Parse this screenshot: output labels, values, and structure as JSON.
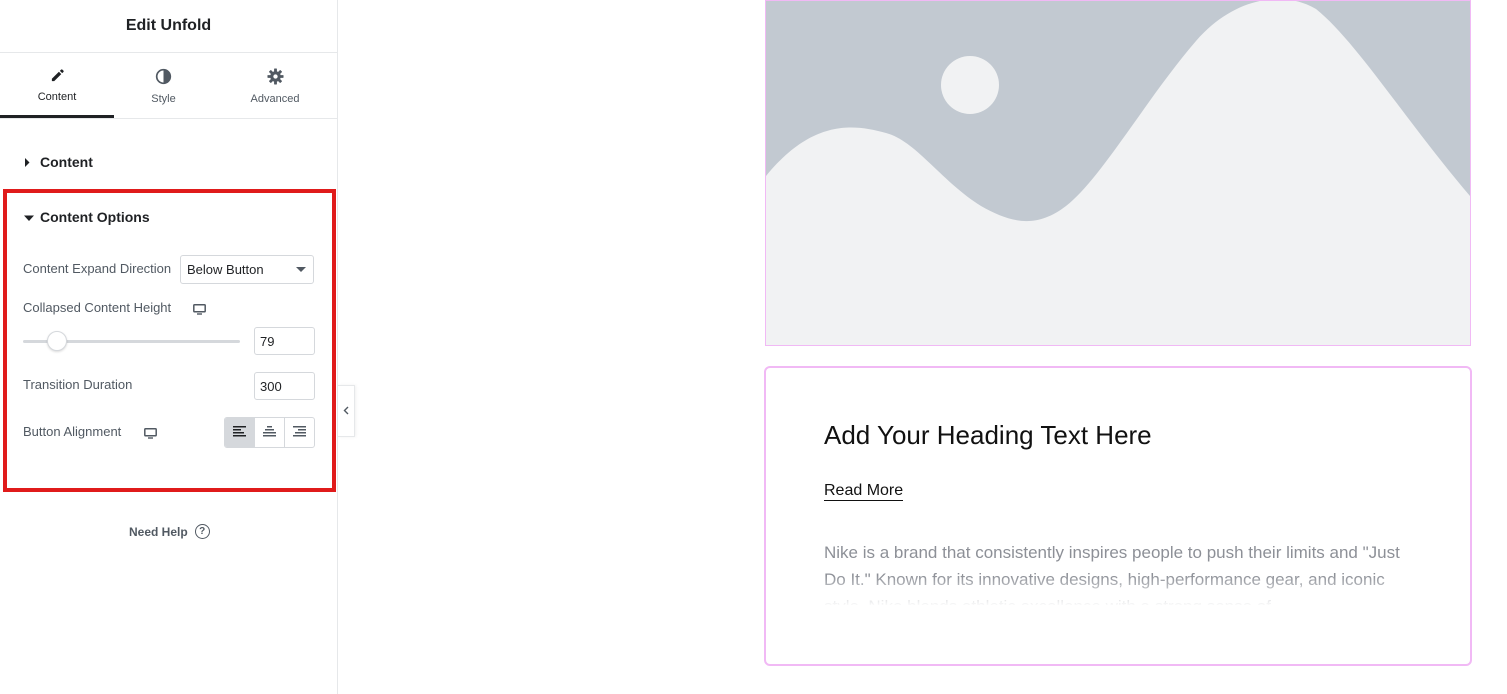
{
  "panel": {
    "title": "Edit Unfold",
    "tabs": [
      {
        "label": "Content",
        "icon": "pencil-icon"
      },
      {
        "label": "Style",
        "icon": "half-circle-icon"
      },
      {
        "label": "Advanced",
        "icon": "gear-icon"
      }
    ],
    "active_tab": "Content",
    "sections": {
      "content": {
        "title": "Content",
        "expanded": false
      },
      "content_options": {
        "title": "Content Options",
        "expanded": true,
        "expand_direction": {
          "label": "Content Expand Direction",
          "value": "Below Button"
        },
        "collapsed_height": {
          "label": "Collapsed Content Height",
          "value": "79",
          "device_icon": "desktop-icon"
        },
        "transition_duration": {
          "label": "Transition Duration",
          "value": "300"
        },
        "button_alignment": {
          "label": "Button Alignment",
          "device_icon": "desktop-icon",
          "options": [
            "left",
            "center",
            "right"
          ],
          "selected": "left"
        }
      }
    },
    "need_help": "Need Help",
    "colors": {
      "highlight": "#e01b1b",
      "text_dark": "#1f2124",
      "text_muted": "#515962"
    }
  },
  "preview": {
    "heading": "Add Your Heading Text Here",
    "read_more": "Read More",
    "paragraph": "Nike is a brand that consistently inspires people to push their limits and \"Just Do It.\" Known for its innovative designs, high-performance gear, and iconic style, Nike blends athletic excellence with a strong sense of",
    "image_placeholder_icon": "image-placeholder-icon",
    "colors": {
      "border": "#f1b9f5",
      "placeholder_bg": "#f1f2f3",
      "placeholder_shape": "#c2c9d1"
    }
  }
}
